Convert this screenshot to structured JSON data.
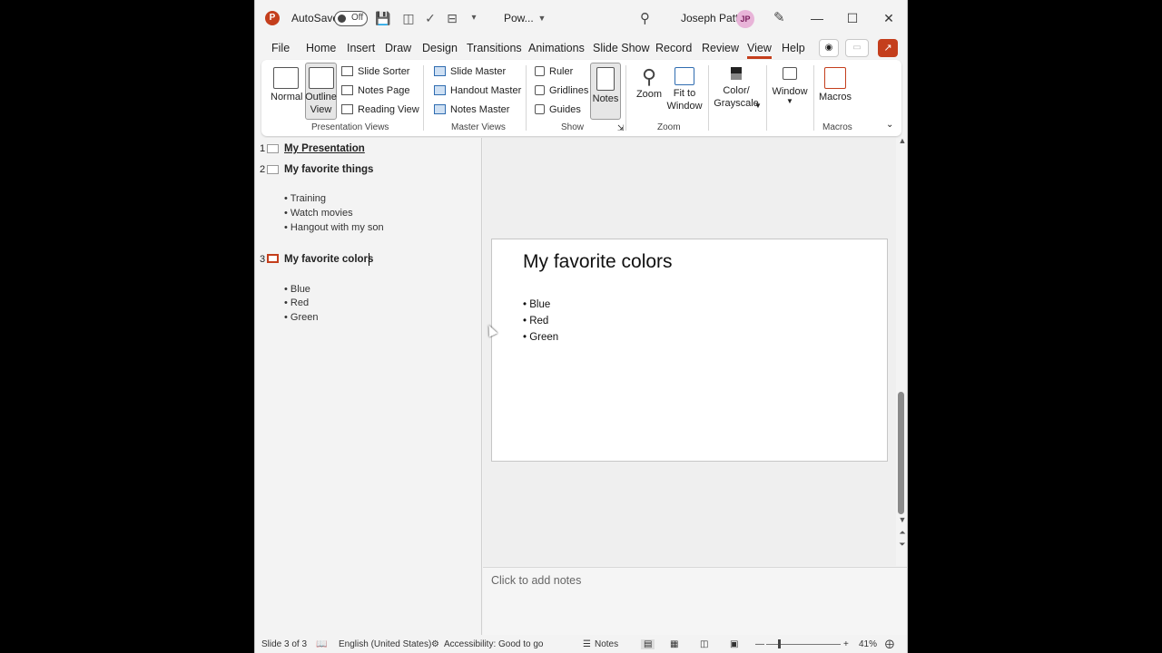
{
  "titlebar": {
    "autosave_label": "AutoSave",
    "toggle_text": "Off",
    "doc_name": "Pow...",
    "user_name": "Joseph Patti",
    "avatar_initials": "JP"
  },
  "tabs": [
    "File",
    "Home",
    "Insert",
    "Draw",
    "Design",
    "Transitions",
    "Animations",
    "Slide Show",
    "Record",
    "Review",
    "View",
    "Help"
  ],
  "active_tab": "View",
  "ribbon": {
    "normal": "Normal",
    "outline_view_1": "Outline",
    "outline_view_2": "View",
    "slide_sorter": "Slide Sorter",
    "notes_page": "Notes Page",
    "reading_view": "Reading View",
    "presentation_views": "Presentation Views",
    "slide_master": "Slide Master",
    "handout_master": "Handout Master",
    "notes_master": "Notes Master",
    "master_views": "Master Views",
    "ruler": "Ruler",
    "gridlines": "Gridlines",
    "guides": "Guides",
    "show": "Show",
    "notes": "Notes",
    "zoom": "Zoom",
    "fit_1": "Fit to",
    "fit_2": "Window",
    "zoom_group": "Zoom",
    "color_1": "Color/",
    "color_2": "Grayscale",
    "window": "Window",
    "macros": "Macros",
    "macros_group": "Macros"
  },
  "outline": {
    "slides": [
      {
        "num": "1",
        "title": "My Presentation",
        "bullets": []
      },
      {
        "num": "2",
        "title": "My favorite things",
        "bullets": [
          "• Training",
          "• Watch movies",
          "• Hangout with my son"
        ]
      },
      {
        "num": "3",
        "title": "My favorite colors",
        "bullets": [
          "• Blue",
          "• Red",
          "• Green"
        ]
      }
    ]
  },
  "slide": {
    "title": "My favorite colors",
    "bullets": [
      "• Blue",
      "• Red",
      "• Green"
    ]
  },
  "notes_placeholder": "Click to add notes",
  "status": {
    "slide_info": "Slide 3 of 3",
    "language": "English (United States)",
    "accessibility": "Accessibility: Good to go",
    "notes": "Notes",
    "zoom": "41%"
  },
  "colors": {
    "accent": "#c43e1c"
  }
}
